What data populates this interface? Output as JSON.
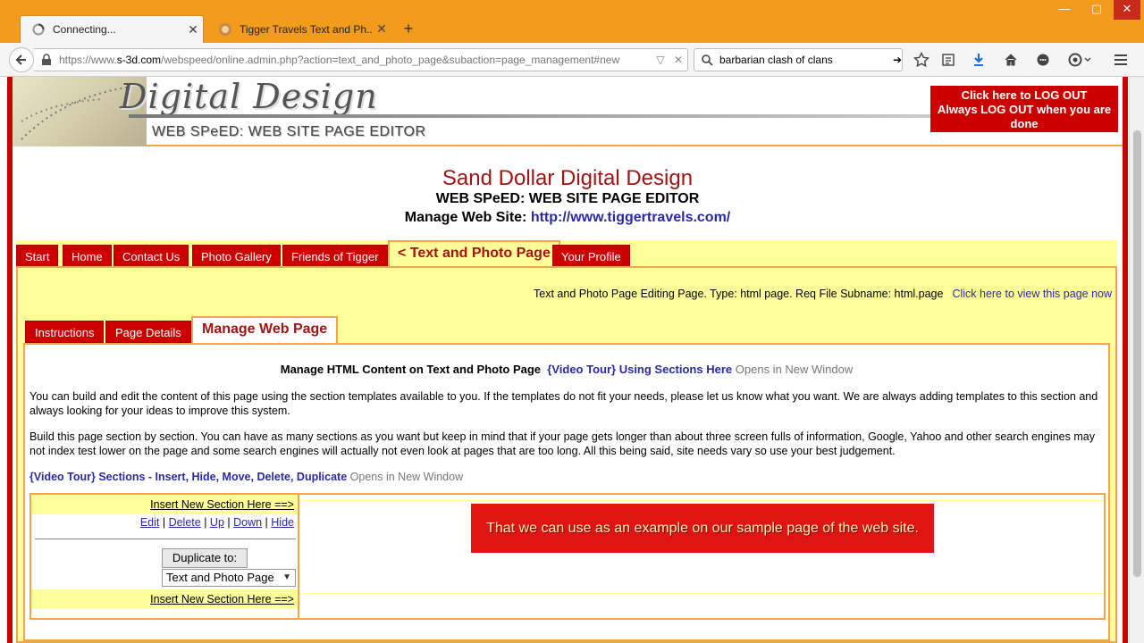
{
  "browser": {
    "tabs": [
      {
        "label": "Connecting...",
        "active": true
      },
      {
        "label": "Tigger Travels Text and Ph...",
        "active": false
      }
    ],
    "url_prefix": "https://www.",
    "url_host": "s-3d.com",
    "url_rest": "/webspeed/online.admin.php?action=text_and_photo_page&subaction=page_management#new",
    "search_value": "barbarian clash of clans"
  },
  "banner": {
    "logo": "Digital Design",
    "subtitle": "WEB SPeED: WEB SITE PAGE EDITOR",
    "logout_line1": "Click here to LOG OUT",
    "logout_line2": "Always LOG OUT when you are done"
  },
  "site": {
    "title": "Sand Dollar Digital Design",
    "subtitle": "WEB SPeED: WEB SITE PAGE EDITOR",
    "manage_label": "Manage Web Site: ",
    "manage_url": "http://www.tiggertravels.com/"
  },
  "main_tabs": [
    {
      "label": "Start"
    },
    {
      "label": "Home"
    },
    {
      "label": "Contact Us"
    },
    {
      "label": "Photo Gallery"
    },
    {
      "label": "Friends of Tigger"
    },
    {
      "label": "< Text and Photo Page",
      "selected": true
    },
    {
      "label": "Your Profile"
    }
  ],
  "panel": {
    "info": "Text and Photo Page Editing Page. Type: html page. Req File Subname: html.page",
    "view_link": "Click here to view this page now"
  },
  "sub_tabs": [
    {
      "label": "Instructions"
    },
    {
      "label": "Page Details"
    },
    {
      "label": "Manage Web Page",
      "selected": true
    }
  ],
  "content": {
    "heading": "Manage HTML Content on Text and Photo Page",
    "video1": "{Video Tour} Using Sections Here",
    "new_window": "Opens in New Window",
    "para1": "You can build and edit the content of this page using the section templates available to you. If the templates do not fit your needs, please let us know what you want. We are always adding templates to this section and always looking for your ideas to improve this system.",
    "para2": "Build this page section by section. You can have as many sections as you want but keep in mind that if your page gets longer than about three screen fulls of information, Google, Yahoo and other search engines may not index test lower on the page and some search engines will actually not even look at pages that are too long. All this being said, site needs vary so use your best judgement.",
    "video2": "{Video Tour} Sections - Insert, Hide, Move, Delete, Duplicate",
    "new_window2": "Opens in New Window"
  },
  "section": {
    "insert_label": "Insert New Section Here ==>",
    "ops": {
      "edit": "Edit",
      "delete": "Delete",
      "up": "Up",
      "down": "Down",
      "hide": "Hide"
    },
    "duplicate_button": "Duplicate to:",
    "duplicate_value": "Text and Photo Page",
    "callout": "That we can use as an example on our sample page of the web site."
  }
}
